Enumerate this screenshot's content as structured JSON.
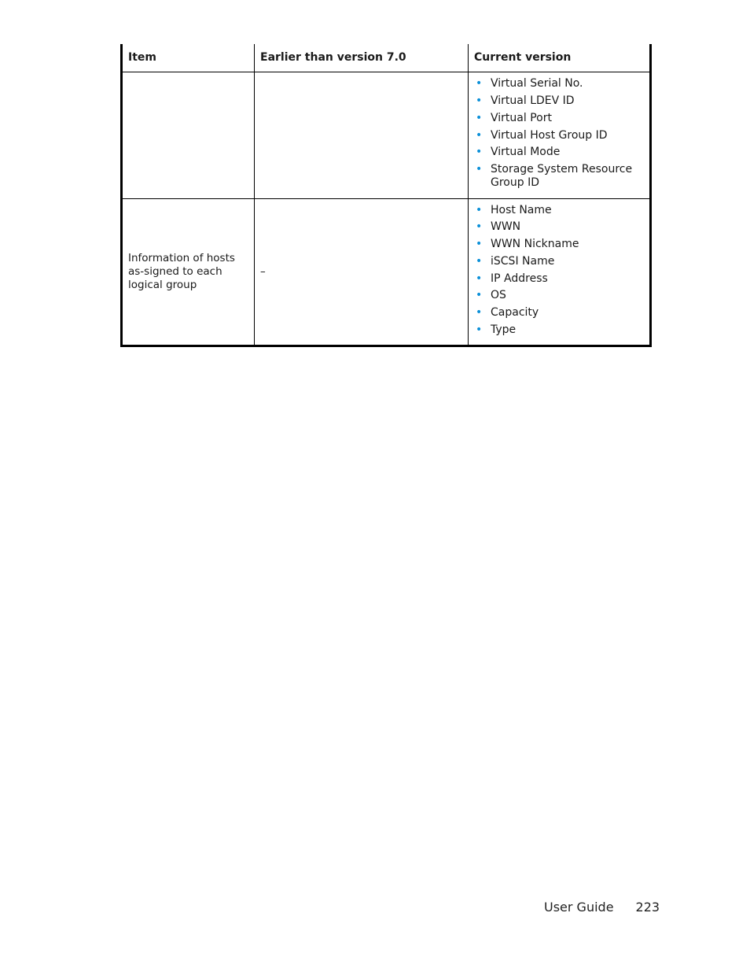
{
  "table": {
    "headers": [
      "Item",
      "Earlier than version 7.0",
      "Current version"
    ],
    "rows": [
      {
        "item": "",
        "earlier": "",
        "current": [
          "Virtual Serial No.",
          "Virtual LDEV ID",
          "Virtual Port",
          "Virtual Host Group ID",
          "Virtual Mode",
          "Storage System Resource Group ID"
        ]
      },
      {
        "item": "Information of hosts as-signed to each logical group",
        "earlier": "–",
        "current": [
          "Host Name",
          "WWN",
          "WWN Nickname",
          "iSCSI Name",
          "IP Address",
          "OS",
          "Capacity",
          "Type"
        ]
      }
    ]
  },
  "bullet": {
    "glyph": "•",
    "color": "#0a8fd8"
  },
  "footer": {
    "label": "User Guide",
    "page": "223"
  }
}
